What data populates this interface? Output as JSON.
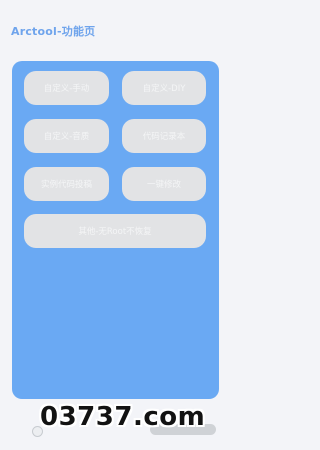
{
  "header": {
    "title": "Arctool-功能页"
  },
  "buttons": [
    {
      "label": "自定义-手动"
    },
    {
      "label": "自定义-DIY"
    },
    {
      "label": "自定义-音质"
    },
    {
      "label": "代码记录本"
    },
    {
      "label": "实例代码投稿"
    },
    {
      "label": "一键修改"
    },
    {
      "label": "其他-无Root不恢复"
    }
  ],
  "watermark": "03737.com",
  "colors": {
    "accent": "#6fa4ec",
    "panel": "#6aa9f3",
    "button_bg": "#e2e3e5",
    "button_text": "#f4f5f6",
    "background": "#f3f4f8"
  }
}
